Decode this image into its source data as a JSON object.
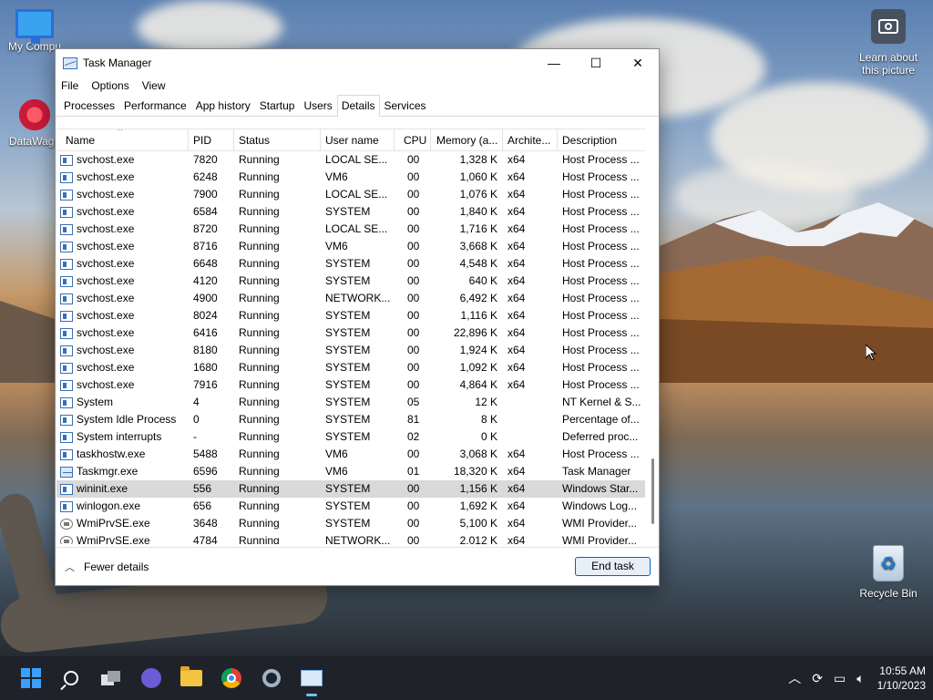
{
  "desktop": {
    "icons": [
      {
        "label": "My Compu",
        "icon": "monitor-icon"
      },
      {
        "label": "DataWago",
        "icon": "datawagon-icon"
      },
      {
        "label": "Learn about this picture",
        "icon": "camera-icon"
      },
      {
        "label": "Recycle Bin",
        "icon": "recycle-bin-icon"
      }
    ]
  },
  "window": {
    "title": "Task Manager",
    "controls": {
      "minimize": "—",
      "maximize": "☐",
      "close": "✕"
    },
    "menu": [
      "File",
      "Options",
      "View"
    ],
    "tabs": [
      "Processes",
      "Performance",
      "App history",
      "Startup",
      "Users",
      "Details",
      "Services"
    ],
    "active_tab": "Details",
    "columns": [
      "Name",
      "PID",
      "Status",
      "User name",
      "CPU",
      "Memory (a...",
      "Archite...",
      "Description"
    ],
    "rows": [
      {
        "name": "svchost.exe",
        "pid": "7820",
        "status": "Running",
        "user": "LOCAL SE...",
        "cpu": "00",
        "mem": "1,328 K",
        "arch": "x64",
        "desc": "Host Process ...",
        "icon": "svc"
      },
      {
        "name": "svchost.exe",
        "pid": "6248",
        "status": "Running",
        "user": "VM6",
        "cpu": "00",
        "mem": "1,060 K",
        "arch": "x64",
        "desc": "Host Process ...",
        "icon": "svc"
      },
      {
        "name": "svchost.exe",
        "pid": "7900",
        "status": "Running",
        "user": "LOCAL SE...",
        "cpu": "00",
        "mem": "1,076 K",
        "arch": "x64",
        "desc": "Host Process ...",
        "icon": "svc"
      },
      {
        "name": "svchost.exe",
        "pid": "6584",
        "status": "Running",
        "user": "SYSTEM",
        "cpu": "00",
        "mem": "1,840 K",
        "arch": "x64",
        "desc": "Host Process ...",
        "icon": "svc"
      },
      {
        "name": "svchost.exe",
        "pid": "8720",
        "status": "Running",
        "user": "LOCAL SE...",
        "cpu": "00",
        "mem": "1,716 K",
        "arch": "x64",
        "desc": "Host Process ...",
        "icon": "svc"
      },
      {
        "name": "svchost.exe",
        "pid": "8716",
        "status": "Running",
        "user": "VM6",
        "cpu": "00",
        "mem": "3,668 K",
        "arch": "x64",
        "desc": "Host Process ...",
        "icon": "svc"
      },
      {
        "name": "svchost.exe",
        "pid": "6648",
        "status": "Running",
        "user": "SYSTEM",
        "cpu": "00",
        "mem": "4,548 K",
        "arch": "x64",
        "desc": "Host Process ...",
        "icon": "svc"
      },
      {
        "name": "svchost.exe",
        "pid": "4120",
        "status": "Running",
        "user": "SYSTEM",
        "cpu": "00",
        "mem": "640 K",
        "arch": "x64",
        "desc": "Host Process ...",
        "icon": "svc"
      },
      {
        "name": "svchost.exe",
        "pid": "4900",
        "status": "Running",
        "user": "NETWORK...",
        "cpu": "00",
        "mem": "6,492 K",
        "arch": "x64",
        "desc": "Host Process ...",
        "icon": "svc"
      },
      {
        "name": "svchost.exe",
        "pid": "8024",
        "status": "Running",
        "user": "SYSTEM",
        "cpu": "00",
        "mem": "1,116 K",
        "arch": "x64",
        "desc": "Host Process ...",
        "icon": "svc"
      },
      {
        "name": "svchost.exe",
        "pid": "6416",
        "status": "Running",
        "user": "SYSTEM",
        "cpu": "00",
        "mem": "22,896 K",
        "arch": "x64",
        "desc": "Host Process ...",
        "icon": "svc"
      },
      {
        "name": "svchost.exe",
        "pid": "8180",
        "status": "Running",
        "user": "SYSTEM",
        "cpu": "00",
        "mem": "1,924 K",
        "arch": "x64",
        "desc": "Host Process ...",
        "icon": "svc"
      },
      {
        "name": "svchost.exe",
        "pid": "1680",
        "status": "Running",
        "user": "SYSTEM",
        "cpu": "00",
        "mem": "1,092 K",
        "arch": "x64",
        "desc": "Host Process ...",
        "icon": "svc"
      },
      {
        "name": "svchost.exe",
        "pid": "7916",
        "status": "Running",
        "user": "SYSTEM",
        "cpu": "00",
        "mem": "4,864 K",
        "arch": "x64",
        "desc": "Host Process ...",
        "icon": "svc"
      },
      {
        "name": "System",
        "pid": "4",
        "status": "Running",
        "user": "SYSTEM",
        "cpu": "05",
        "mem": "12 K",
        "arch": "",
        "desc": "NT Kernel & S...",
        "icon": "svc"
      },
      {
        "name": "System Idle Process",
        "pid": "0",
        "status": "Running",
        "user": "SYSTEM",
        "cpu": "81",
        "mem": "8 K",
        "arch": "",
        "desc": "Percentage of...",
        "icon": "svc"
      },
      {
        "name": "System interrupts",
        "pid": "-",
        "status": "Running",
        "user": "SYSTEM",
        "cpu": "02",
        "mem": "0 K",
        "arch": "",
        "desc": "Deferred proc...",
        "icon": "svc"
      },
      {
        "name": "taskhostw.exe",
        "pid": "5488",
        "status": "Running",
        "user": "VM6",
        "cpu": "00",
        "mem": "3,068 K",
        "arch": "x64",
        "desc": "Host Process ...",
        "icon": "svc"
      },
      {
        "name": "Taskmgr.exe",
        "pid": "6596",
        "status": "Running",
        "user": "VM6",
        "cpu": "01",
        "mem": "18,320 K",
        "arch": "x64",
        "desc": "Task Manager",
        "icon": "tm"
      },
      {
        "name": "wininit.exe",
        "pid": "556",
        "status": "Running",
        "user": "SYSTEM",
        "cpu": "00",
        "mem": "1,156 K",
        "arch": "x64",
        "desc": "Windows Star...",
        "icon": "svc",
        "selected": true
      },
      {
        "name": "winlogon.exe",
        "pid": "656",
        "status": "Running",
        "user": "SYSTEM",
        "cpu": "00",
        "mem": "1,692 K",
        "arch": "x64",
        "desc": "Windows Log...",
        "icon": "svc"
      },
      {
        "name": "WmiPrvSE.exe",
        "pid": "3648",
        "status": "Running",
        "user": "SYSTEM",
        "cpu": "00",
        "mem": "5,100 K",
        "arch": "x64",
        "desc": "WMI Provider...",
        "icon": "gear"
      },
      {
        "name": "WmiPrvSE.exe",
        "pid": "4784",
        "status": "Running",
        "user": "NETWORK...",
        "cpu": "00",
        "mem": "2,012 K",
        "arch": "x64",
        "desc": "WMI Provider...",
        "icon": "gear"
      }
    ],
    "footer": {
      "fewer_details": "Fewer details",
      "end_task": "End task"
    }
  },
  "taskbar": {
    "apps": [
      "start-icon",
      "search-icon",
      "task-view-icon",
      "meet-icon",
      "file-explorer-icon",
      "chrome-icon",
      "settings-icon",
      "task-manager-icon"
    ],
    "tray": {
      "time": "10:55 AM",
      "date": "1/10/2023"
    }
  },
  "colors": {
    "accent": "#0067c0",
    "selected_row": "#d9d9d9",
    "taskbar": "#1f2329"
  }
}
